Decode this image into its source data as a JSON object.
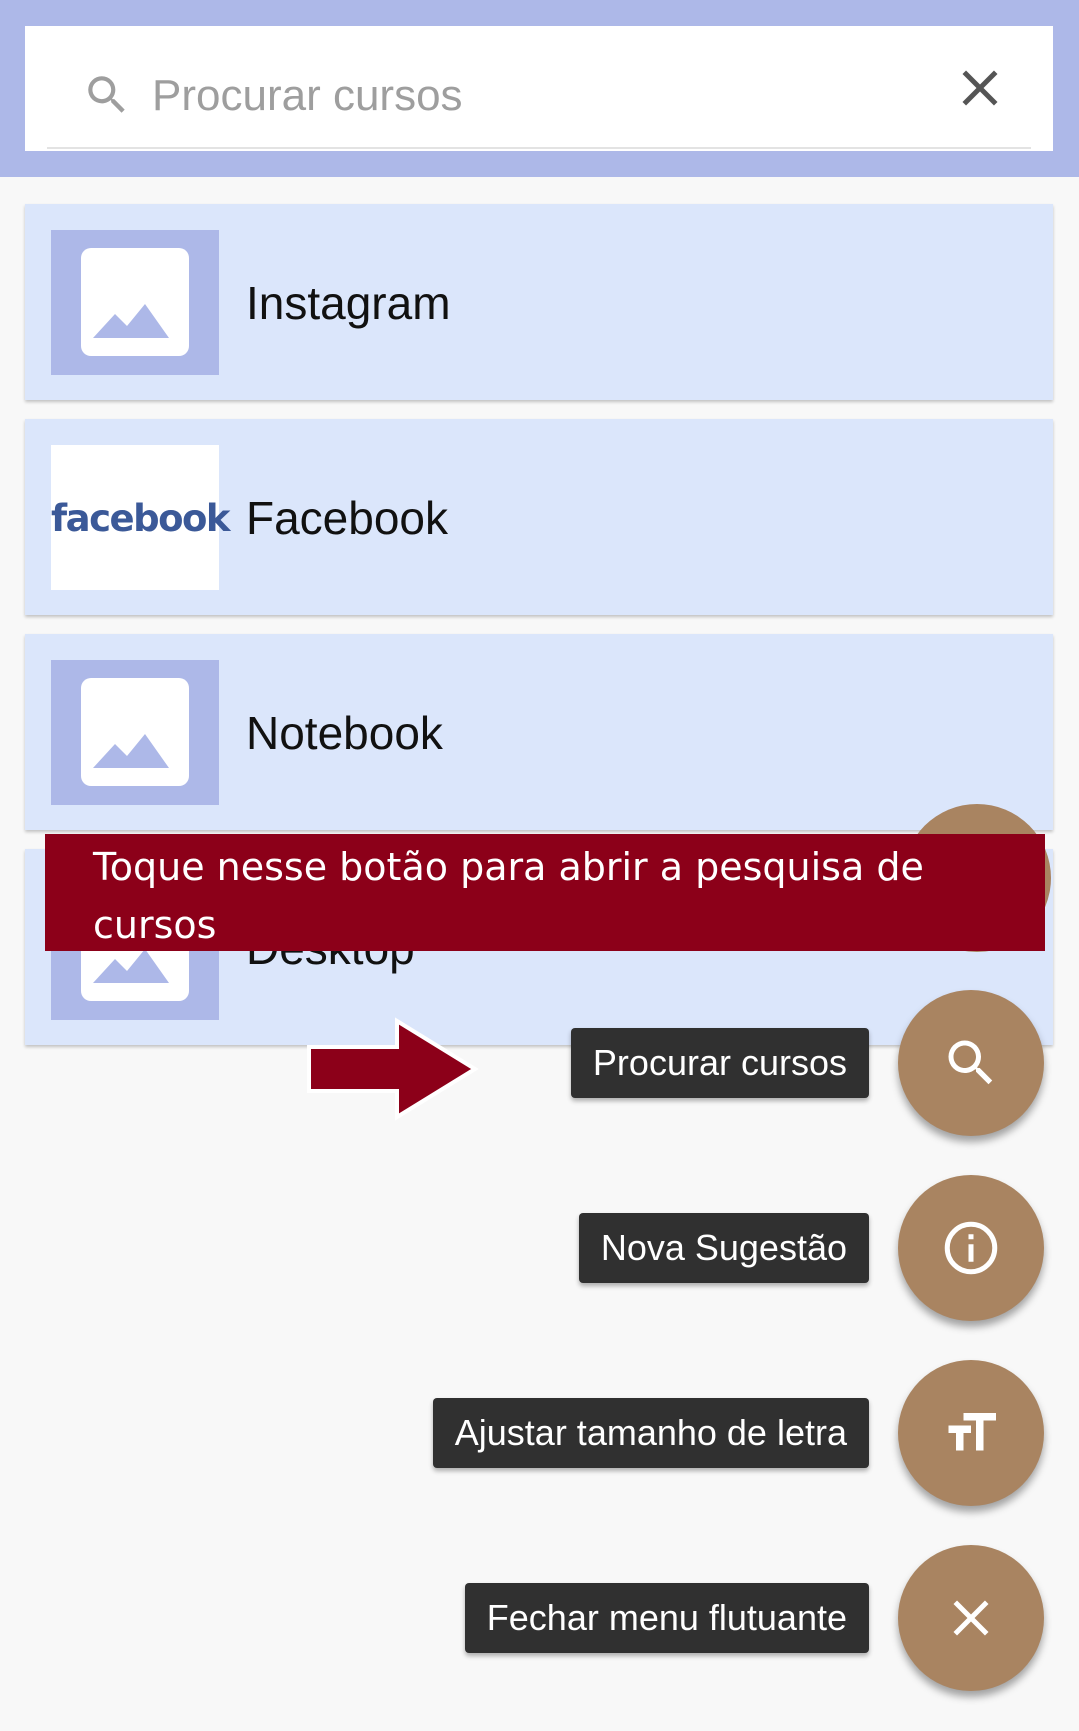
{
  "search": {
    "placeholder": "Procurar cursos",
    "value": ""
  },
  "courses": [
    {
      "title": "Instagram",
      "thumbnail": "placeholder-image"
    },
    {
      "title": "Facebook",
      "thumbnail": "facebook-logo",
      "logo_text": "facebook"
    },
    {
      "title": "Notebook",
      "thumbnail": "placeholder-image"
    },
    {
      "title": "Desktop",
      "thumbnail": "placeholder-image"
    }
  ],
  "tutorial": {
    "message": "Toque nesse botão para abrir a pesquisa de cursos",
    "arrow_icon": "arrow-right-icon"
  },
  "fab_menu": [
    {
      "label": "Procurar cursos",
      "icon": "search-icon"
    },
    {
      "label": "Nova Sugestão",
      "icon": "info-icon"
    },
    {
      "label": "Ajustar tamanho de letra",
      "icon": "text-size-icon"
    },
    {
      "label": "Fechar menu flutuante",
      "icon": "close-icon"
    }
  ],
  "colors": {
    "topbar": "#adb8e8",
    "card": "#dbe6fb",
    "fab": "#a98461",
    "tutorial_banner": "#8c0019",
    "label_bg": "#303030",
    "facebook": "#3b5998"
  }
}
